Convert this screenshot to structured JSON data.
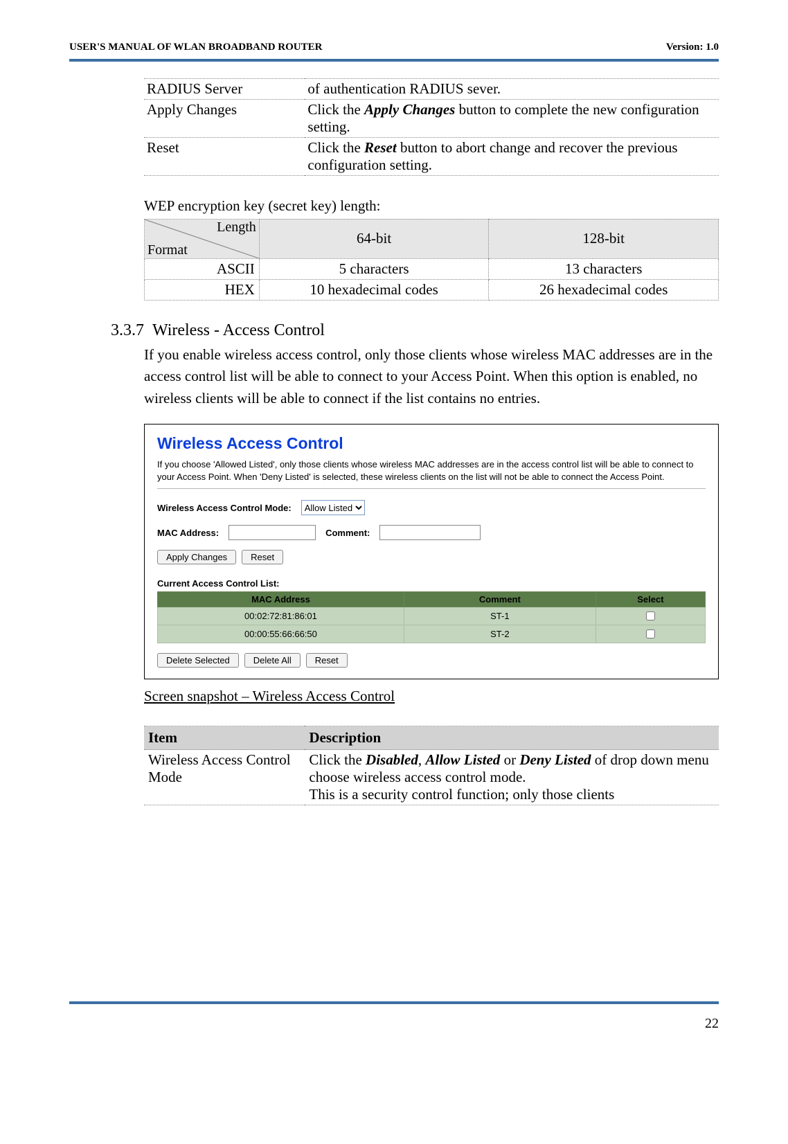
{
  "header": {
    "left": "USER'S MANUAL OF WLAN BROADBAND ROUTER",
    "right": "Version: 1.0"
  },
  "params_table": {
    "rows": [
      {
        "item": "RADIUS Server",
        "desc_pre": "of authentication RADIUS sever.",
        "bold": "",
        "desc_post": ""
      },
      {
        "item": "Apply Changes",
        "desc_pre": "Click the ",
        "bold": "Apply Changes",
        "desc_post": " button to complete the new configuration setting."
      },
      {
        "item": "Reset",
        "desc_pre": "Click the ",
        "bold": "Reset",
        "desc_post": " button to abort change and recover the previous configuration setting."
      }
    ]
  },
  "wep": {
    "intro": "WEP encryption key (secret key) length:",
    "corner_top": "Length",
    "corner_bottom": "Format",
    "col64": "64-bit",
    "col128": "128-bit",
    "rows": [
      {
        "fmt": "ASCII",
        "c64": "5 characters",
        "c128": "13 characters"
      },
      {
        "fmt": "HEX",
        "c64": "10 hexadecimal codes",
        "c128": "26 hexadecimal codes"
      }
    ]
  },
  "section": {
    "num": "3.3.7",
    "title": "Wireless - Access Control",
    "body": "If you enable wireless access control, only those clients whose wireless MAC addresses are in the access control list will be able to connect to your Access Point. When this option is enabled, no wireless clients will be able to connect if the list contains no entries."
  },
  "screenshot": {
    "title": "Wireless Access Control",
    "desc": "If you choose 'Allowed Listed', only those clients whose wireless MAC addresses are in the access control list will be able to connect to your Access Point. When 'Deny Listed' is selected, these wireless clients on the list will not be able to connect the Access Point.",
    "mode_label": "Wireless Access Control Mode:",
    "mode_value": "Allow Listed",
    "mac_label": "MAC Address:",
    "comment_label": "Comment:",
    "apply_btn": "Apply Changes",
    "reset_btn": "Reset",
    "list_header": "Current Access Control List:",
    "cols": {
      "mac": "MAC Address",
      "comment": "Comment",
      "select": "Select"
    },
    "rows": [
      {
        "mac": "00:02:72:81:86:01",
        "comment": "ST-1"
      },
      {
        "mac": "00:00:55:66:66:50",
        "comment": "ST-2"
      }
    ],
    "delete_selected": "Delete Selected",
    "delete_all": "Delete All",
    "reset2": "Reset"
  },
  "caption": "Screen snapshot – Wireless Access Control",
  "itemdesc": {
    "col_item": "Item",
    "col_desc": "Description",
    "row_item": "Wireless Access Control Mode",
    "row_desc_pre": "Click the ",
    "b1": "Disabled",
    "sep1": ", ",
    "b2": "Allow Listed",
    "mid": " or ",
    "b3": "Deny Listed",
    "post": " of drop down menu choose wireless access control mode.",
    "line2": "This is a security control function; only those clients"
  },
  "page_number": "22"
}
